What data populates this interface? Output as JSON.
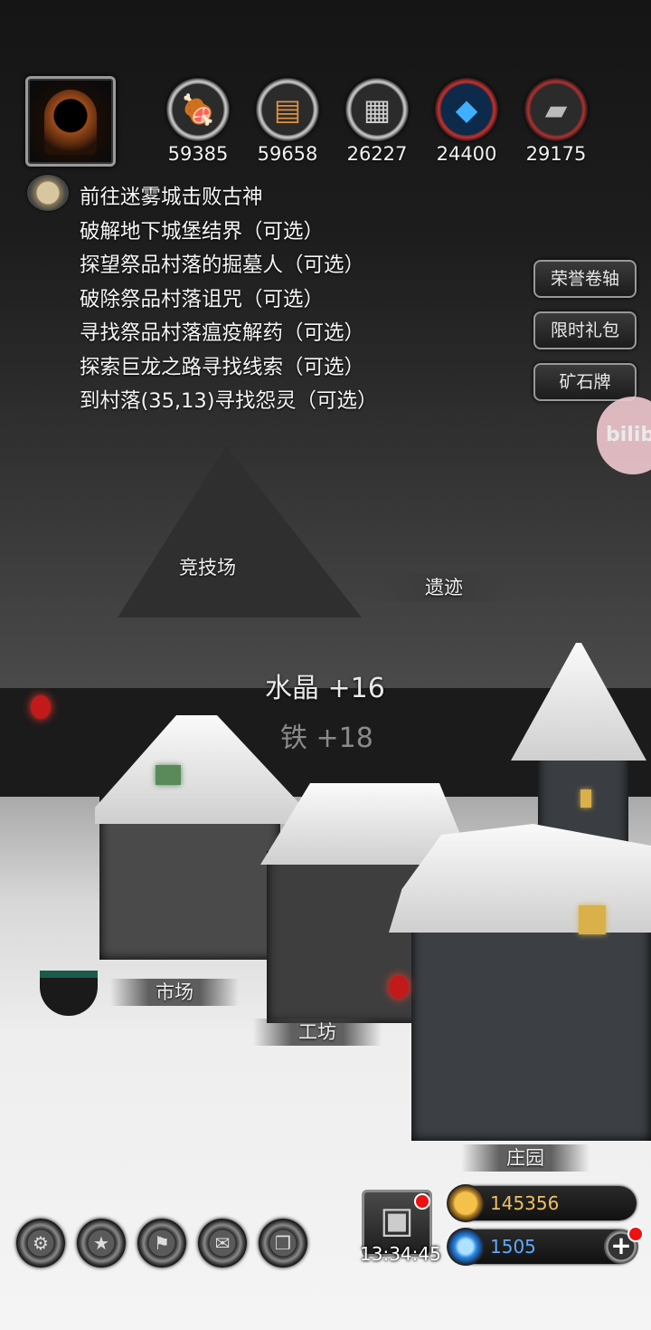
{
  "resources": [
    {
      "name": "meat",
      "icon": "meat-icon",
      "glyph": "🍖",
      "value": "59385"
    },
    {
      "name": "wood",
      "icon": "wood-icon",
      "glyph": "▤",
      "value": "59658"
    },
    {
      "name": "stone",
      "icon": "stone-icon",
      "glyph": "▦",
      "value": "26227"
    },
    {
      "name": "crystal",
      "icon": "crystal-icon",
      "glyph": "◆",
      "value": "24400"
    },
    {
      "name": "iron",
      "icon": "iron-icon",
      "glyph": "▰",
      "value": "29175"
    }
  ],
  "quests": [
    "前往迷雾城击败古神",
    "破解地下城堡结界（可选）",
    "探望祭品村落的掘墓人（可选）",
    "破除祭品村落诅咒（可选）",
    "寻找祭品村落瘟疫解药（可选）",
    "探索巨龙之路寻找线索（可选）",
    "到村落(35,13)寻找怨灵（可选）"
  ],
  "side_buttons": {
    "honor_scroll": "荣誉卷轴",
    "limited_pack": "限时礼包",
    "ore_card": "矿石牌"
  },
  "watermark": "bilib",
  "locations": {
    "arena": "竞技场",
    "ruins": "遗迹",
    "market": "市场",
    "workshop": "工坊",
    "manor": "庄园"
  },
  "floating_gains": {
    "crystal": "水晶 +16",
    "iron": "铁 +18"
  },
  "gift": {
    "timer": "13:34:45",
    "icon": "gift-box-icon"
  },
  "currency": {
    "gold": "145356",
    "gems": "1505"
  },
  "bottom_icons": [
    "settings-icon",
    "achievement-icon",
    "banner-icon",
    "mail-icon",
    "box-icon"
  ],
  "colors": {
    "gold_text": "#f0c060",
    "gem_text": "#5fa8ff",
    "badge_red": "#e11"
  }
}
